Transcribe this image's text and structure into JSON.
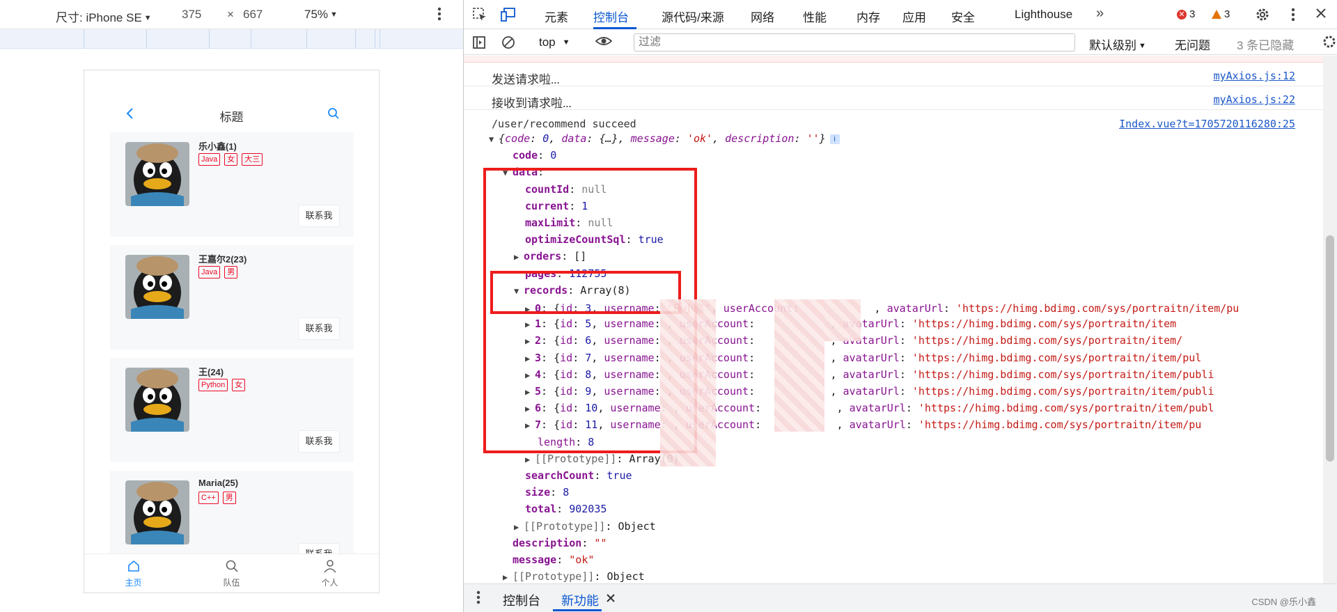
{
  "device_toolbar": {
    "dimensions_label": "尺寸: iPhone SE",
    "width": "375",
    "times": "×",
    "height": "667",
    "zoom": "75%"
  },
  "app": {
    "header_title": "标题",
    "contact_label": "联系我",
    "users": [
      {
        "name": "乐小鑫(1)",
        "tags": [
          "Java",
          "女",
          "大三"
        ]
      },
      {
        "name": "王嘉尔2(23)",
        "tags": [
          "Java",
          "男"
        ]
      },
      {
        "name": "王(24)",
        "tags": [
          "Python",
          "女"
        ]
      },
      {
        "name": "Maria(25)",
        "tags": [
          "C++",
          "男"
        ]
      }
    ],
    "tabbar": [
      {
        "label": "主页",
        "icon": "home-icon",
        "active": true
      },
      {
        "label": "队伍",
        "icon": "search-icon",
        "active": false
      },
      {
        "label": "个人",
        "icon": "user-icon",
        "active": false
      }
    ]
  },
  "devtools": {
    "tabs": [
      "元素",
      "控制台",
      "源代码/来源",
      "网络",
      "性能",
      "内存",
      "应用",
      "安全",
      "Lighthouse"
    ],
    "active_tab": "控制台",
    "error_count": "3",
    "warning_count": "3",
    "console_toolbar": {
      "context": "top",
      "filter_placeholder": "过滤",
      "level": "默认级别",
      "issues": "无问题",
      "hidden": "3 条已隐藏"
    },
    "drawer": {
      "tab1": "控制台",
      "tab2": "新功能"
    },
    "watermark": "CSDN @乐小鑫"
  },
  "console": {
    "messages": [
      {
        "text": "发送请求啦...",
        "source": "myAxios.js:12"
      },
      {
        "text": "接收到请求啦...",
        "source": "myAxios.js:22"
      },
      {
        "text": "/user/recommend succeed",
        "source": "Index.vue?t=1705720116280:25"
      }
    ],
    "summary": {
      "code": "0",
      "message": "'ok'",
      "description": "''"
    },
    "code": "0",
    "data": {
      "countId": "null",
      "current": "1",
      "maxLimit": "null",
      "optimizeCountSql": "true",
      "orders": "[]",
      "pages": "112755",
      "records_label": "Array(8)",
      "records": [
        {
          "i": "0",
          "id": "3",
          "username": "'乐小鑫'",
          "avatarUrl": "'https://himg.bdimg.com/sys/portraitn/item/pu"
        },
        {
          "i": "1",
          "id": "5",
          "username": "",
          "avatarUrl": "'https://himg.bdimg.com/sys/portraitn/item"
        },
        {
          "i": "2",
          "id": "6",
          "username": "",
          "avatarUrl": "'https://himg.bdimg.com/sys/portraitn/item/"
        },
        {
          "i": "3",
          "id": "7",
          "username": "",
          "avatarUrl": "'https://himg.bdimg.com/sys/portraitn/item/pul"
        },
        {
          "i": "4",
          "id": "8",
          "username": "",
          "avatarUrl": "'https://himg.bdimg.com/sys/portraitn/item/publi"
        },
        {
          "i": "5",
          "id": "9",
          "username": "",
          "avatarUrl": "'https://himg.bdimg.com/sys/portraitn/item/publi"
        },
        {
          "i": "6",
          "id": "10",
          "username": "",
          "avatarUrl": "'https://himg.bdimg.com/sys/portraitn/item/publ"
        },
        {
          "i": "7",
          "id": "11",
          "username": "",
          "avatarUrl": "'https://himg.bdimg.com/sys/portraitn/item/pu"
        }
      ],
      "length": "8",
      "records_proto": "Array(0)",
      "searchCount": "true",
      "size": "8",
      "total": "902035"
    },
    "data_proto": "Object",
    "description": "\"\"",
    "message": "\"ok\"",
    "root_proto": "Object"
  }
}
